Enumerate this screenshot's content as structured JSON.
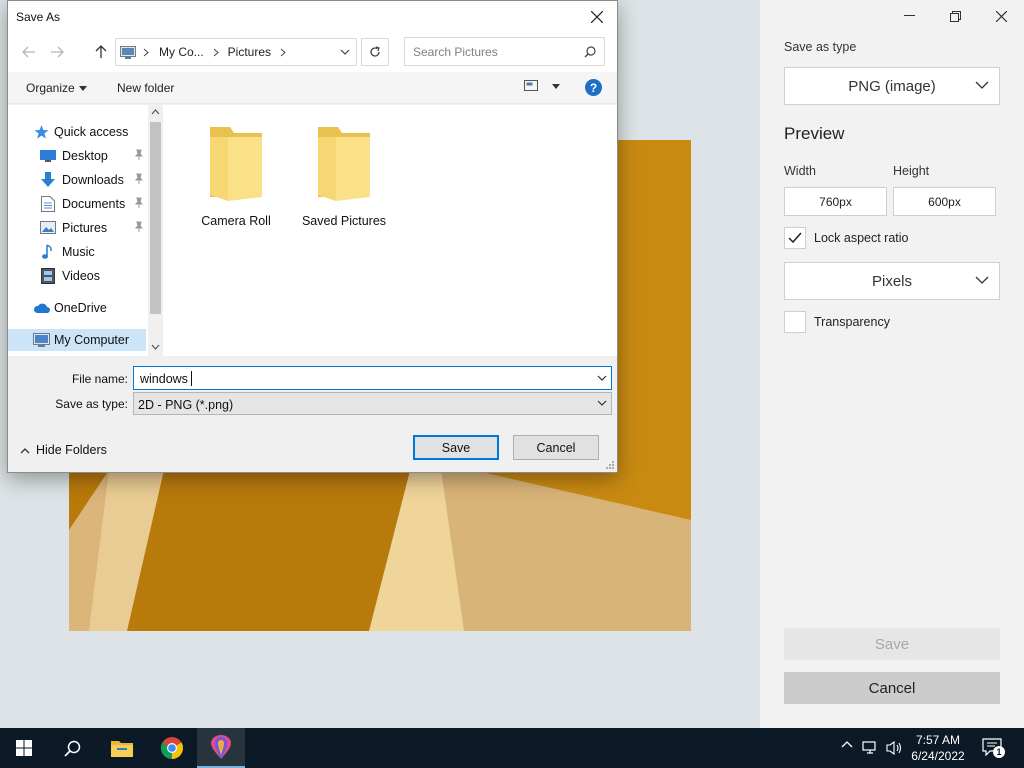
{
  "dialog": {
    "title": "Save As",
    "breadcrumb": [
      "My Co...",
      "Pictures"
    ],
    "search_placeholder": "Search Pictures",
    "toolbar": {
      "organize": "Organize",
      "new_folder": "New folder"
    },
    "nav_items": [
      {
        "label": "Quick access",
        "icon": "star-icon"
      },
      {
        "label": "Desktop",
        "icon": "desktop-icon",
        "pinned": true
      },
      {
        "label": "Downloads",
        "icon": "download-arrow-icon",
        "pinned": true
      },
      {
        "label": "Documents",
        "icon": "document-icon",
        "pinned": true
      },
      {
        "label": "Pictures",
        "icon": "pictures-icon",
        "pinned": true
      },
      {
        "label": "Music",
        "icon": "music-note-icon"
      },
      {
        "label": "Videos",
        "icon": "film-icon"
      },
      {
        "label": "OneDrive",
        "icon": "cloud-icon"
      },
      {
        "label": "My Computer",
        "icon": "monitor-icon",
        "selected": true
      }
    ],
    "folders": [
      "Camera Roll",
      "Saved Pictures"
    ],
    "file_name_label": "File name:",
    "file_name_value": "windows",
    "save_type_label": "Save as type:",
    "save_type_value": "2D - PNG (*.png)",
    "hide_folders": "Hide Folders",
    "save_button": "Save",
    "cancel_button": "Cancel",
    "accent_color": "#0078d7"
  },
  "panel": {
    "save_as_type_label": "Save as type",
    "save_as_type_value": "PNG (image)",
    "preview_heading": "Preview",
    "width_label": "Width",
    "height_label": "Height",
    "width_value": "760px",
    "height_value": "600px",
    "lock_aspect_label": "Lock aspect ratio",
    "lock_aspect_checked": true,
    "units_value": "Pixels",
    "transparency_label": "Transparency",
    "transparency_checked": false,
    "save_button": "Save",
    "cancel_button": "Cancel"
  },
  "taskbar": {
    "time": "7:57 AM",
    "date": "6/24/2022",
    "notification_count": "1",
    "apps": [
      "start-icon",
      "search-icon",
      "file-explorer-icon",
      "chrome-icon",
      "paint-3d-icon"
    ]
  }
}
